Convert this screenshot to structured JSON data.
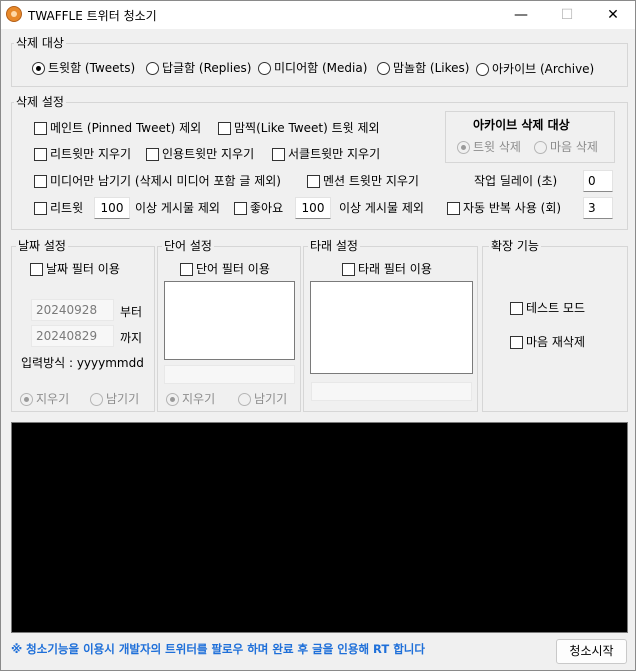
{
  "window": {
    "title": "TWAFFLE 트위터 청소기",
    "minimize_glyph": "—",
    "maximize_glyph": "☐",
    "close_glyph": "✕",
    "icon": "app-logo-icon"
  },
  "target": {
    "legend": "삭제 대상",
    "options": [
      {
        "label": "트윗함 (Tweets)",
        "selected": true
      },
      {
        "label": "답글함 (Replies)",
        "selected": false
      },
      {
        "label": "미디어함 (Media)",
        "selected": false
      },
      {
        "label": "맘놀함 (Likes)",
        "selected": false
      },
      {
        "label": "아카이브 (Archive)",
        "selected": false
      }
    ]
  },
  "settings": {
    "legend": "삭제 설정",
    "exclude_pinned": "메인트 (Pinned Tweet) 제외",
    "exclude_like_tweet": "맘찍(Like Tweet) 트윗 제외",
    "retweets_only": "리트윗만 지우기",
    "quotes_only": "인용트윗만 지우기",
    "threads_only": "서클트윗만 지우기",
    "media_only": "미디어만 남기기 (삭제시 미디어 포함 글 제외)",
    "mentions_only": "멘션 트윗만 지우기",
    "retweet_label": "리트윗",
    "retweet_threshold": "100",
    "retweet_suffix": "이상 게시물 제외",
    "likes_label": "좋아요",
    "likes_threshold": "100",
    "likes_suffix": "이상 게시물 제외",
    "delay_label": "작업 딜레이 (초)",
    "delay_value": "0",
    "auto_repeat": "자동 반복 사용 (회)",
    "repeat_value": "3"
  },
  "archive_target": {
    "title": "아카이브 삭제 대상",
    "options": [
      {
        "label": "트윗 삭제",
        "selected": true
      },
      {
        "label": "마음 삭제",
        "selected": false
      }
    ]
  },
  "date_settings": {
    "legend": "날짜 설정",
    "use_filter": "날짜 필터 이용",
    "from_value": "20240928",
    "from_label": "부터",
    "to_value": "20240829",
    "to_label": "까지",
    "format_hint": "입력방식 : yyyymmdd",
    "delete_label": "지우기",
    "keep_label": "남기기"
  },
  "word_settings": {
    "legend": "단어 설정",
    "use_filter": "단어 필터 이용",
    "delete_label": "지우기",
    "keep_label": "남기기"
  },
  "other_settings": {
    "legend": "타래 설정",
    "use_filter": "타래 필터 이용"
  },
  "extensions": {
    "legend": "확장 기능",
    "test_mode": "테스트 모드",
    "redelete_likes": "마음 재삭제"
  },
  "footer": {
    "notice": "※ 청소기능을 이용시 개발자의 트위터를 팔로우 하며 완료 후 글을 인용해 RT 합니다",
    "start_button": "청소시작"
  }
}
